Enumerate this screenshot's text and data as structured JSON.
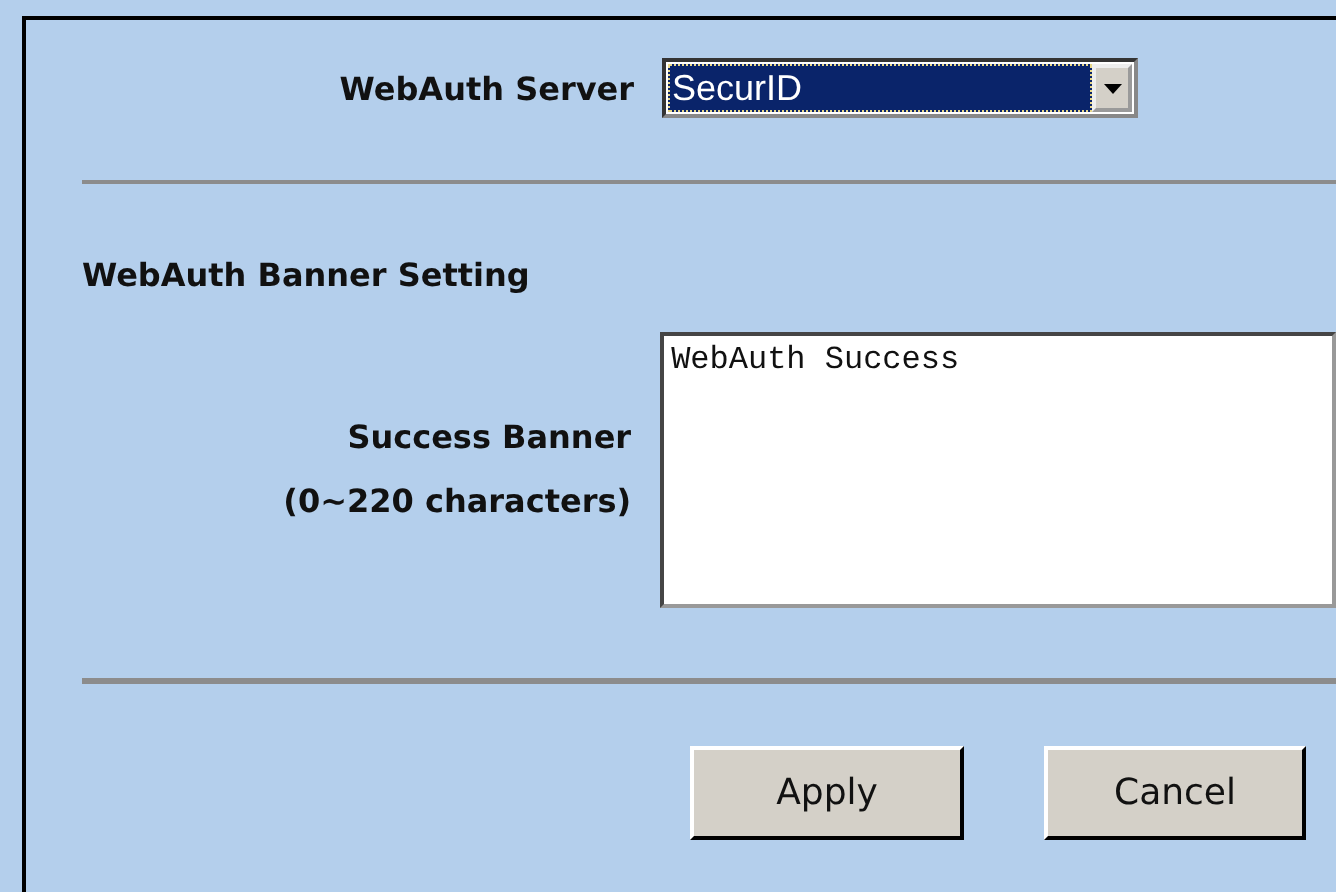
{
  "server": {
    "label": "WebAuth Server",
    "value": "SecurID"
  },
  "banner_section": {
    "title": "WebAuth Banner Setting",
    "label": "Success Banner",
    "hint": "(0~220 characters)",
    "value": "WebAuth Success"
  },
  "buttons": [
    "Apply",
    "Cancel"
  ]
}
